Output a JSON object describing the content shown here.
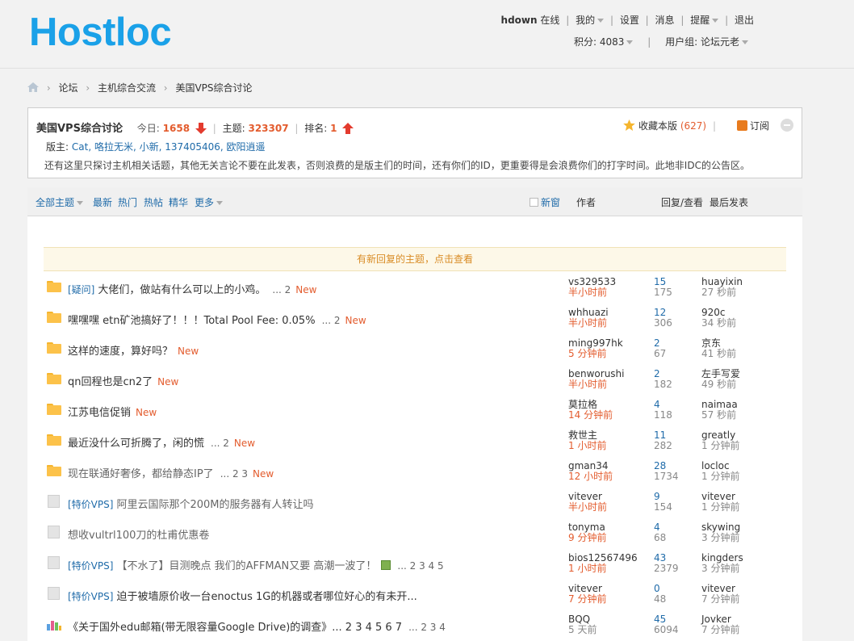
{
  "header": {
    "logo": "Hostloc",
    "user": {
      "name": "hdown",
      "status": "在线",
      "my_label": "我的",
      "settings_label": "设置",
      "messages_label": "消息",
      "reminders_label": "提醒",
      "logout_label": "退出",
      "points_label": "积分: 4083",
      "group_label": "用户组: 论坛元老"
    }
  },
  "breadcrumb": [
    "论坛",
    "主机综合交流",
    "美国VPS综合讨论"
  ],
  "forum": {
    "name": "美国VPS综合讨论",
    "today_label": "今日:",
    "today": "1658",
    "topics_label": "主题:",
    "topics": "323307",
    "rank_label": "排名:",
    "rank": "1",
    "favorite_label": "收藏本版",
    "favorite_count": "(627)",
    "subscribe_label": "订阅",
    "moderators_label": "版主:",
    "moderators": "Cat, 咯拉无米, 小新, 137405406, 欧阳逍遥",
    "description": "还有这里只探讨主机相关话题，其他无关言论不要在此发表，否则浪费的是版主们的时间，还有你们的ID，更重要得是会浪费你们的打字时间。此地非IDC的公告区。"
  },
  "tabs": {
    "all": "全部主题",
    "latest": "最新",
    "hot": "热门",
    "hotposts": "热帖",
    "digest": "精华",
    "more": "更多",
    "new_window": "新窗",
    "author": "作者",
    "replies_views": "回复/查看",
    "last_post": "最后发表"
  },
  "new_reply_notice": "有新回复的主题，点击查看",
  "threads": [
    {
      "icon": "folder-yellow",
      "prefix": "[疑问]",
      "title": "大佬们，做站有什么可以上的小鸡。",
      "pages": "... 2",
      "new": "New",
      "author": "vs329533",
      "author_time": "半小时前",
      "replies": "15",
      "views": "175",
      "last_user": "huayixin",
      "last_time": "27 秒前"
    },
    {
      "icon": "folder-yellow",
      "prefix": "",
      "title": "嘿嘿嘿 etn矿池搞好了！！！Total Pool Fee: 0.05%",
      "pages": "... 2",
      "new": "New",
      "author": "whhuazi",
      "author_time": "半小时前",
      "replies": "12",
      "views": "306",
      "last_user": "920c",
      "last_time": "34 秒前"
    },
    {
      "icon": "folder-yellow",
      "prefix": "",
      "title": "这样的速度，算好吗？",
      "pages": "",
      "new": "New",
      "author": "ming997hk",
      "author_time": "5 分钟前",
      "replies": "2",
      "views": "67",
      "last_user": "京东",
      "last_time": "41 秒前"
    },
    {
      "icon": "folder-yellow",
      "prefix": "",
      "title": "qn回程也是cn2了",
      "pages": "",
      "new": "New",
      "author": "benworushi",
      "author_time": "半小时前",
      "replies": "2",
      "views": "182",
      "last_user": "左手写爱",
      "last_time": "49 秒前"
    },
    {
      "icon": "folder-yellow",
      "prefix": "",
      "title": "江苏电信促销",
      "pages": "",
      "new": "New",
      "author": "莫拉格",
      "author_time": "14 分钟前",
      "replies": "4",
      "views": "118",
      "last_user": "naimaa",
      "last_time": "57 秒前"
    },
    {
      "icon": "folder-yellow",
      "prefix": "",
      "title": "最近没什么可折腾了，闲的慌",
      "pages": "... 2",
      "new": "New",
      "author": "救世主",
      "author_time": "1 小时前",
      "replies": "11",
      "views": "282",
      "last_user": "greatly",
      "last_time": "1 分钟前"
    },
    {
      "icon": "folder-yellow",
      "prefix": "",
      "title": "现在联通好奢侈，都给静态IP了",
      "pages": "... 2  3",
      "new": "New",
      "author": "gman34",
      "author_time": "12 小时前",
      "replies": "28",
      "views": "1734",
      "last_user": "locloc",
      "last_time": "1 分钟前",
      "gray": true
    },
    {
      "icon": "doc-gray",
      "prefix": "[特价VPS]",
      "title": "阿里云国际那个200M的服务器有人转让吗",
      "pages": "",
      "new": "",
      "author": "vitever",
      "author_time": "半小时前",
      "replies": "9",
      "views": "154",
      "last_user": "vitever",
      "last_time": "1 分钟前",
      "gray": true
    },
    {
      "icon": "doc-gray",
      "prefix": "",
      "title": "想收vultrl100刀的杜甫优惠卷",
      "pages": "",
      "new": "",
      "author": "tonyma",
      "author_time": "9 分钟前",
      "replies": "4",
      "views": "68",
      "last_user": "skywing",
      "last_time": "3 分钟前",
      "gray": true
    },
    {
      "icon": "doc-gray",
      "prefix": "[特价VPS]",
      "title": "【不水了】目测晚点 我们的AFFMAN又要 高潮一波了！",
      "pages": "... 2  3  4  5",
      "new": "",
      "image": true,
      "author": "bios12567496",
      "author_time": "1 小时前",
      "replies": "43",
      "views": "2379",
      "last_user": "kingders",
      "last_time": "3 分钟前",
      "gray": true
    },
    {
      "icon": "doc-gray",
      "prefix": "[特价VPS]",
      "title": "迫于被墙原价收一台enoctus 1G的机器或者哪位好心的有未开...",
      "pages": "",
      "new": "",
      "author": "vitever",
      "author_time": "7 分钟前",
      "replies": "0",
      "views": "48",
      "last_user": "vitever",
      "last_time": "7 分钟前"
    },
    {
      "icon": "poll",
      "prefix": "",
      "title": "《关于国外edu邮箱(带无限容量Google Drive)的调查》... 2 3 4 5 6 7",
      "pages": "... 2  3  4",
      "new": "",
      "author": "BQQ",
      "author_time": "5 天前",
      "author_time_gray": true,
      "replies": "45",
      "views": "6094",
      "last_user": "Jovker",
      "last_time": "7 分钟前"
    }
  ]
}
